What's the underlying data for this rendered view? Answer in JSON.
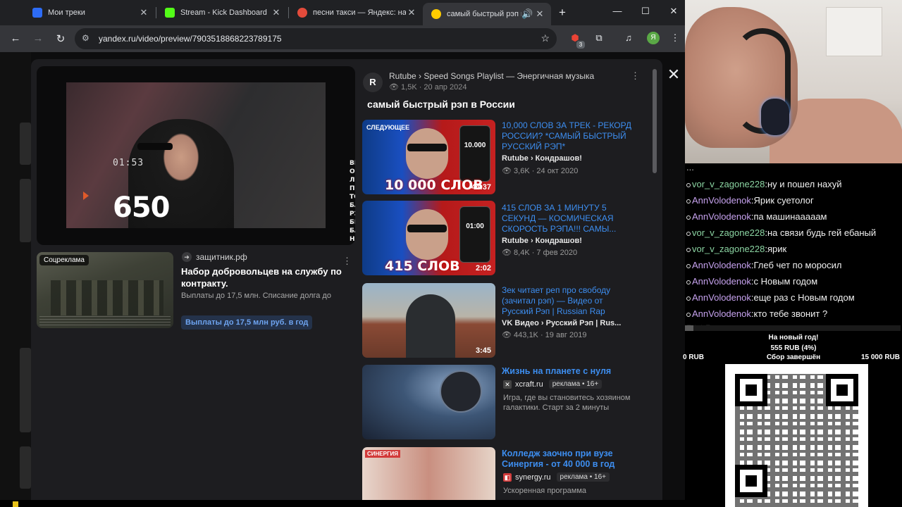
{
  "tabs": [
    {
      "title": "Мои треки",
      "icon": "pause-icon",
      "color": "#2d6cf6"
    },
    {
      "title": "Stream - Kick Dashboard",
      "icon": "kick-icon",
      "color": "#53fc18"
    },
    {
      "title": "песни такси — Яндекс: на",
      "icon": "yandex-icon",
      "color": "#e34b3b"
    },
    {
      "title": "самый быстрый рэп в",
      "icon": "yandex-video-icon",
      "color": "#ffcc00",
      "active": true
    }
  ],
  "address_bar": {
    "url": "yandex.ru/video/preview/7903518868223789175"
  },
  "extensions": {
    "badge_count": "3",
    "profile_letter": "Я"
  },
  "player": {
    "timer": "01:53",
    "overlay_number": "650",
    "side_text": "ВЫ ОКО ЛЮЕ ПОН ТОЛ БАМ РЭП БИТ БАРА НЕ О ГОРІ"
  },
  "ad": {
    "badge": "Соцреклама",
    "source": "защитник.рф",
    "title": "Набор добровольцев на службу по контракту.",
    "description": "Выплаты до 17,5 млн. Списание долга до",
    "cta": "Выплаты до 17,5 млн руб. в год"
  },
  "channel": {
    "logo_letter": "R",
    "path": "Rutube › Speed Songs Playlist — Энергичная музыка",
    "meta": "1,5K · 20 апр 2024"
  },
  "video_title": "самый быстрый рэп в России",
  "recommendations": [
    {
      "title": "10,000 СЛОВ ЗА ТРЕК - РЕКОРД РОССИИ? *САМЫЙ БЫСТРЫЙ РУССКИЙ РЭП*",
      "channel": "Rutube › Кондрашов!",
      "meta": "3,6K · 24 окт 2020",
      "duration": "44:37",
      "next_label": "СЛЕДУЮЩЕЕ",
      "caption": "10 000 СЛОВ",
      "phone_text": "10.000"
    },
    {
      "title": "415 СЛОВ ЗА 1 МИНУТУ 5 СЕКУНД — КОСМИЧЕСКАЯ СКОРОСТЬ РЭПА!!! САМЫ...",
      "channel": "Rutube › Кондрашов!",
      "meta": "8,4K · 7 фев 2020",
      "duration": "2:02",
      "caption": "415 СЛОВ",
      "phone_text": "01:00"
    },
    {
      "title": "Зек читает реп про свободу (зачитал рэп) — Видео от Русский Рэп | Russian Rap",
      "channel": "VK Видео › Русский Рэп | Rus...",
      "meta": "443,1K · 19 авг 2019",
      "duration": "3:45"
    }
  ],
  "promoted": [
    {
      "title": "Жизнь на планете с нуля",
      "domain": "xcraft.ru",
      "label": "реклама • 16+",
      "description": "Игра, где вы становитесь хозяином галактики. Старт за 2 минуты"
    },
    {
      "title": "Колледж заочно при вузе Синергия - от 40 000 в год",
      "domain": "synergy.ru",
      "label": "реклама • 16+",
      "description": "Ускоренная программа",
      "thumb_label": "СИНЕРГИЯ"
    }
  ],
  "chat": {
    "cut_line": "...",
    "messages": [
      {
        "user": "vor_v_zagone228",
        "text": "ну и пошел нахуй",
        "kind": "u1"
      },
      {
        "user": "AnnVolodenok",
        "text": "Ярик суетолог",
        "kind": "u2"
      },
      {
        "user": "AnnVolodenok",
        "text": "па машинааааам",
        "kind": "u2"
      },
      {
        "user": "vor_v_zagone228",
        "text": "на связи будь гей ебаный",
        "kind": "u1"
      },
      {
        "user": "vor_v_zagone228",
        "text": "ярик",
        "kind": "u1"
      },
      {
        "user": "AnnVolodenok",
        "text": "Глеб чет по моросил",
        "kind": "u2"
      },
      {
        "user": "AnnVolodenok",
        "text": "с Новым годом",
        "kind": "u2"
      },
      {
        "user": "AnnVolodenok",
        "text": "еще раз с Новым годом",
        "kind": "u2"
      },
      {
        "user": "AnnVolodenok",
        "text": "кто тебе звонит ?",
        "kind": "u2"
      }
    ]
  },
  "donation": {
    "title": "На новый год!",
    "sum": "555 RUB (4%)",
    "progress": 0.04,
    "min": "0 RUB",
    "status": "Сбор завершён",
    "max": "15 000 RUB"
  }
}
